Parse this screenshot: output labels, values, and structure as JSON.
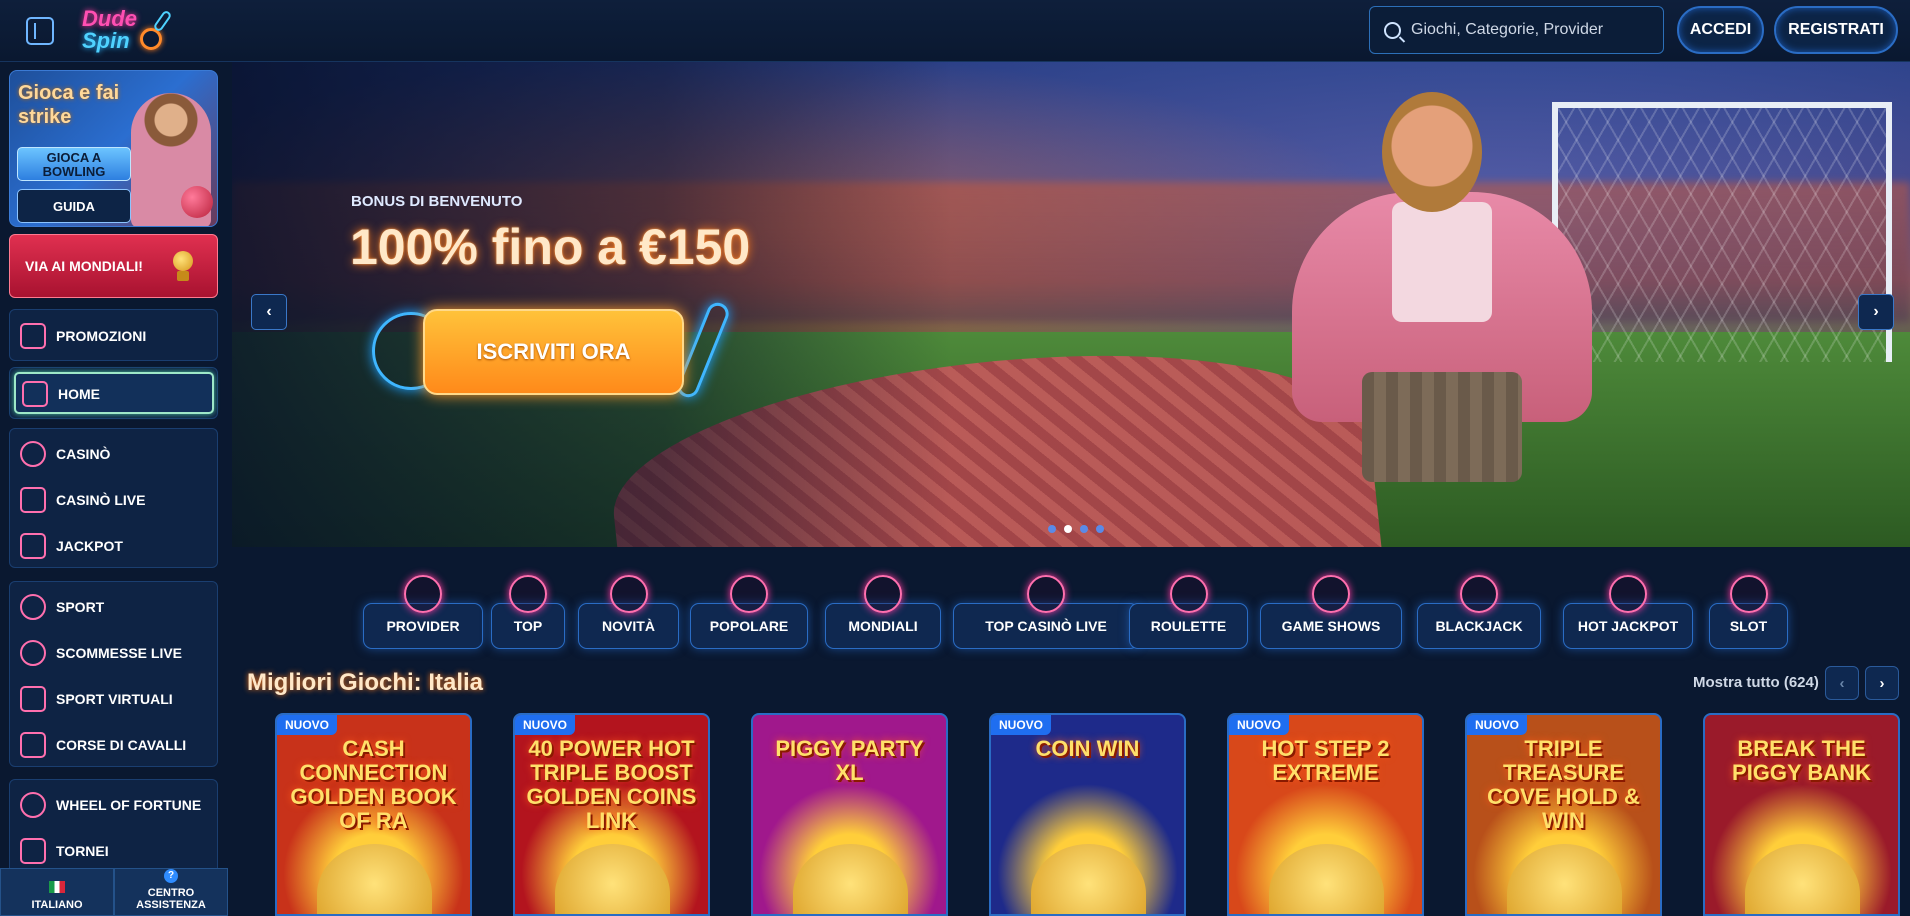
{
  "header": {
    "logo_line1": "Dude",
    "logo_line2": "Spin",
    "search_placeholder": "Giochi, Categorie, Provider",
    "login_label": "ACCEDI",
    "register_label": "REGISTRATI"
  },
  "sidebar": {
    "promo": {
      "title": "Gioca e fai strike",
      "primary_button": "GIOCA A BOWLING",
      "secondary_button": "GUIDA"
    },
    "mondiali_button": "VIA AI MONDIALI!",
    "promotions": "PROMOZIONI",
    "home": "HOME",
    "casino_group": [
      "CASINÒ",
      "CASINÒ LIVE",
      "JACKPOT"
    ],
    "sport_group": [
      "SPORT",
      "SCOMMESSE LIVE",
      "SPORT VIRTUALI",
      "CORSE DI CAVALLI"
    ],
    "extra_group": [
      "WHEEL OF FORTUNE",
      "TORNEI"
    ],
    "language_label": "ITALIANO",
    "help_label": "CENTRO ASSISTENZA",
    "help_glyph": "?"
  },
  "hero": {
    "eyebrow": "BONUS DI BENVENUTO",
    "headline": "100% fino a €150",
    "cta_label": "ISCRIVITI ORA",
    "prev_glyph": "‹",
    "next_glyph": "›",
    "slides": 4,
    "active_slide": 2
  },
  "categories": [
    {
      "label": "PROVIDER",
      "icon": "book-icon"
    },
    {
      "label": "TOP",
      "icon": "star-icon"
    },
    {
      "label": "NOVITÀ",
      "icon": "lightning-icon"
    },
    {
      "label": "POPOLARE",
      "icon": "flame-icon"
    },
    {
      "label": "MONDIALI",
      "icon": "soccer-ball-icon"
    },
    {
      "label": "TOP CASINÒ LIVE",
      "icon": "crown-icon"
    },
    {
      "label": "ROULETTE",
      "icon": "roulette-icon"
    },
    {
      "label": "GAME SHOWS",
      "icon": "microphone-icon"
    },
    {
      "label": "BLACKJACK",
      "icon": "cards-icon"
    },
    {
      "label": "HOT JACKPOT",
      "icon": "hot-jackpot-icon"
    },
    {
      "label": "SLOT",
      "icon": "cherries-icon"
    }
  ],
  "section": {
    "title": "Migliori Giochi: Italia",
    "show_all": "Mostra tutto (624)",
    "prev_glyph": "‹",
    "next_glyph": "›"
  },
  "games": [
    {
      "title": "CASH CONNECTION GOLDEN BOOK OF RA",
      "badge": "NUOVO",
      "bg": "#c8321a"
    },
    {
      "title": "40 POWER HOT TRIPLE BOOST GOLDEN COINS LINK",
      "badge": "NUOVO",
      "bg": "#b3141e"
    },
    {
      "title": "PIGGY PARTY XL",
      "badge": "",
      "bg": "#a0188c"
    },
    {
      "title": "COIN WIN",
      "badge": "NUOVO",
      "bg": "#1e2a8a"
    },
    {
      "title": "HOT STEP 2 EXTREME",
      "badge": "NUOVO",
      "bg": "#d8481a"
    },
    {
      "title": "TRIPLE TREASURE COVE HOLD & WIN",
      "badge": "NUOVO",
      "bg": "#b8501a"
    },
    {
      "title": "BREAK THE PIGGY BANK",
      "badge": "",
      "bg": "#9a1a2a"
    }
  ]
}
